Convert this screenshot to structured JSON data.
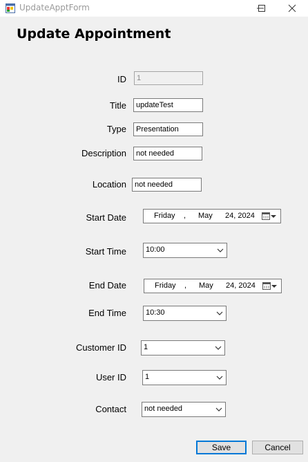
{
  "window": {
    "title": "UpdateApptForm",
    "controls": [
      "minimize-icon",
      "maximize-icon",
      "close-icon"
    ]
  },
  "form": {
    "heading": "Update Appointment",
    "fields": {
      "id": {
        "label": "ID",
        "value": "1"
      },
      "title": {
        "label": "Title",
        "value": "updateTest"
      },
      "type": {
        "label": "Type",
        "value": "Presentation"
      },
      "description": {
        "label": "Description",
        "value": "not needed"
      },
      "location": {
        "label": "Location",
        "value": "not needed"
      },
      "start_date": {
        "label": "Start Date",
        "weekday": "Friday",
        "sep": ",",
        "month": "May",
        "day_year": "24, 2024"
      },
      "start_time": {
        "label": "Start Time",
        "value": "10:00"
      },
      "end_date": {
        "label": "End Date",
        "weekday": "Friday",
        "sep": ",",
        "month": "May",
        "day_year": "24, 2024"
      },
      "end_time": {
        "label": "End Time",
        "value": "10:30"
      },
      "customer_id": {
        "label": "Customer ID",
        "value": "1"
      },
      "user_id": {
        "label": "User ID",
        "value": "1"
      },
      "contact": {
        "label": "Contact",
        "value": "not needed"
      }
    },
    "buttons": {
      "save": "Save",
      "cancel": "Cancel"
    }
  },
  "colors": {
    "background": "#f0f0f0",
    "default_button_border": "#0078d7"
  }
}
